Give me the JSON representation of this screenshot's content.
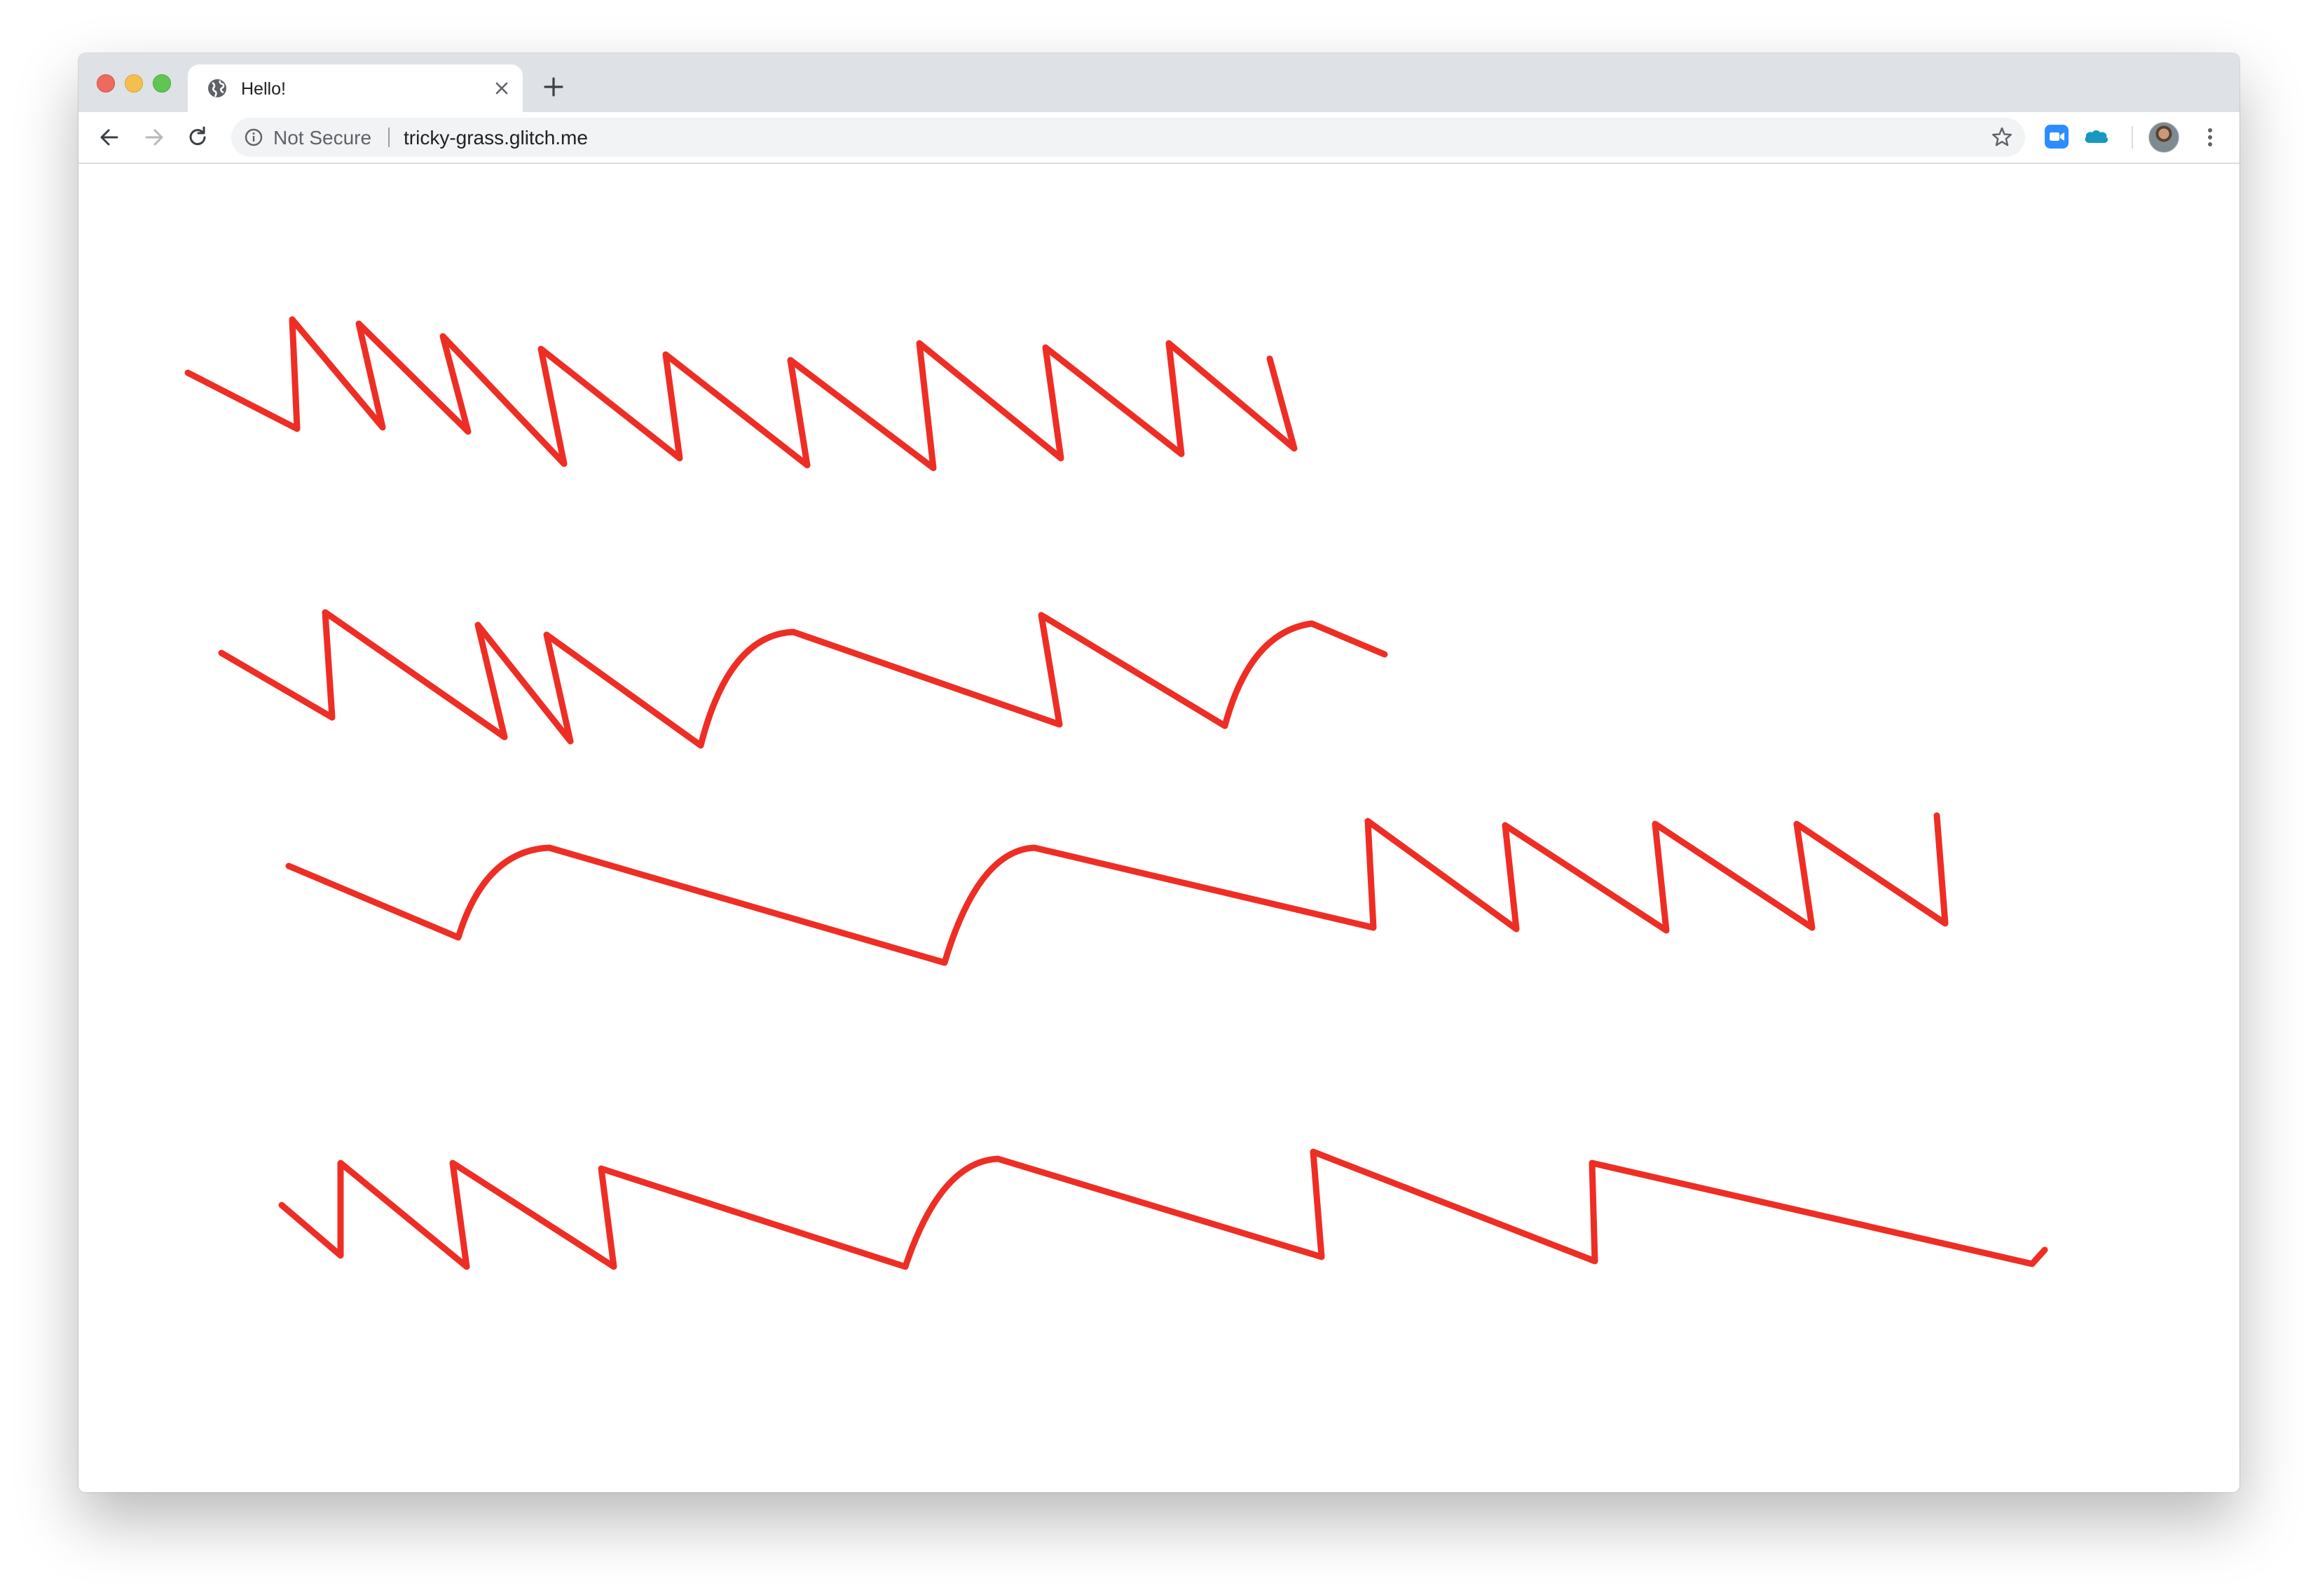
{
  "browser": {
    "tab": {
      "title": "Hello!",
      "favicon": "globe-icon"
    },
    "toolbar": {
      "back": "back-arrow-icon",
      "forward": "forward-arrow-icon",
      "reload": "reload-icon"
    },
    "omnibox": {
      "security_label": "Not Secure",
      "url": "tricky-grass.glitch.me",
      "info_icon": "info-icon",
      "bookmark_icon": "star-icon"
    },
    "extensions": [
      "zoom-extension-icon",
      "salesforce-extension-icon"
    ],
    "profile": "avatar",
    "menu": "more-vert-icon"
  },
  "page": {
    "stroke_color": "#ee2e24",
    "rows": [
      {
        "name": "squiggle-row-1",
        "style": "short-waves",
        "wave_count": 10
      },
      {
        "name": "squiggle-row-2",
        "style": "mixed-waves",
        "wave_count": 7
      },
      {
        "name": "squiggle-row-3",
        "style": "mixed-waves",
        "wave_count": 7
      },
      {
        "name": "squiggle-row-4",
        "style": "mixed-waves",
        "wave_count": 7
      }
    ]
  }
}
